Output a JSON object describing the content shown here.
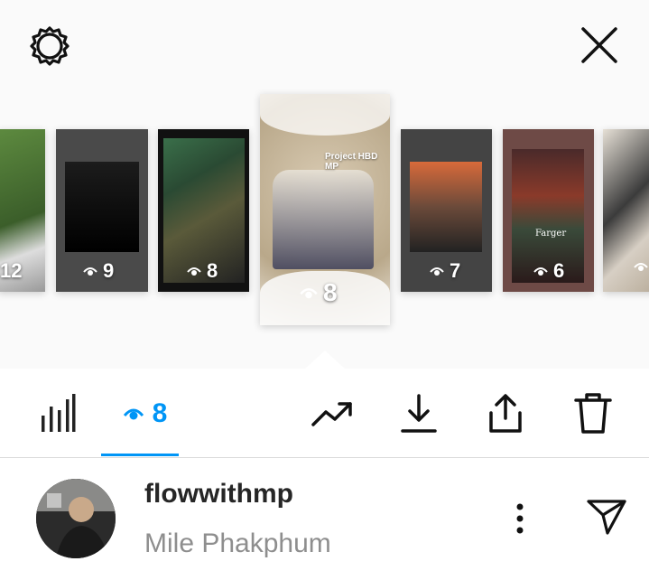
{
  "header": {
    "settings_icon": "gear-icon",
    "close_icon": "close-icon"
  },
  "stories": [
    {
      "views": "12"
    },
    {
      "views": "9"
    },
    {
      "views": "8"
    },
    {
      "views": "8",
      "selected": true,
      "caption": "Project HBD MP"
    },
    {
      "views": "7"
    },
    {
      "views": "6",
      "caption": "Farger"
    },
    {
      "views": ""
    }
  ],
  "toolbar": {
    "viewers_count": "8",
    "icons": [
      "bar-chart-icon",
      "eye-icon",
      "trend-up-icon",
      "download-icon",
      "share-icon",
      "trash-icon"
    ]
  },
  "viewer": {
    "username": "flowwithmp",
    "full_name": "Mile Phakphum"
  },
  "colors": {
    "accent": "#0095f6",
    "text_primary": "#262626",
    "text_secondary": "#8e8e8e"
  }
}
